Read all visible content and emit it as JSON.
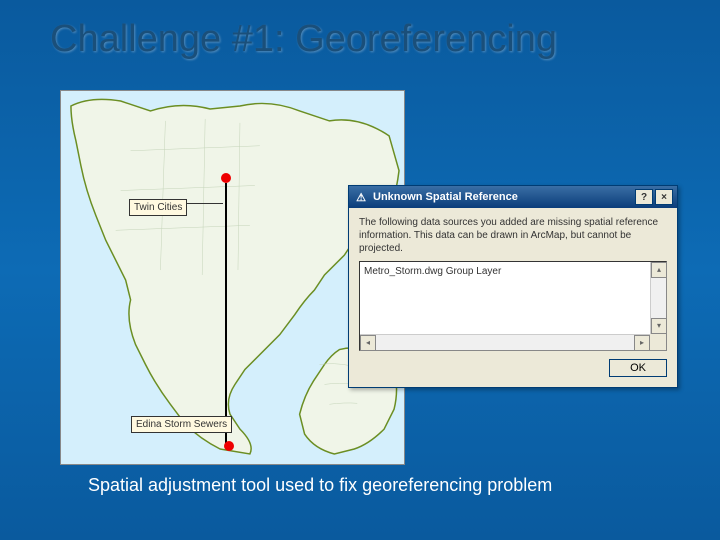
{
  "slide": {
    "title": "Challenge #1: Georeferencing",
    "caption": "Spatial adjustment tool used to fix georeferencing problem"
  },
  "map": {
    "label_top": "Twin Cities",
    "label_bottom": "Edina Storm Sewers"
  },
  "dialog": {
    "title": "Unknown Spatial Reference",
    "message": "The following data sources you added are missing spatial reference information. This data can be drawn in ArcMap, but cannot be projected.",
    "list_item": "Metro_Storm.dwg Group Layer",
    "ok_label": "OK",
    "help_symbol": "?",
    "close_symbol": "×"
  },
  "icons": {
    "warning": "⚠"
  }
}
